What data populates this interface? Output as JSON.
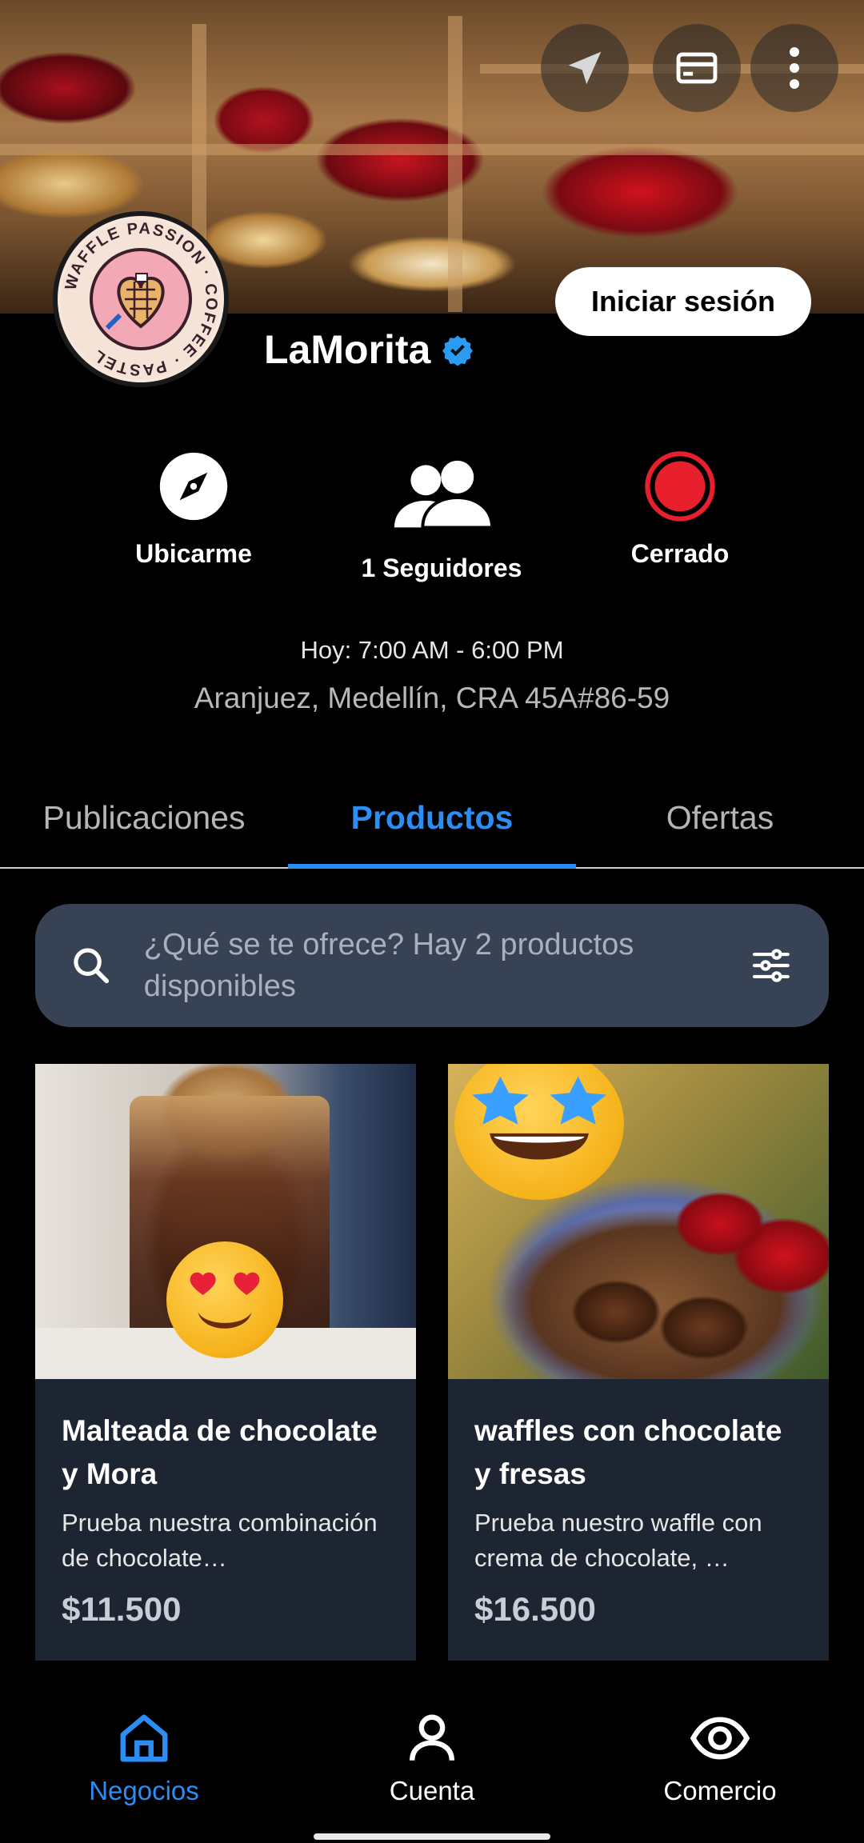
{
  "header": {
    "login_label": "Iniciar sesión",
    "logo_text": "WAFFLE PASSION · COFFEE · PASTEL",
    "business_name": "LaMorita"
  },
  "actions": [
    {
      "label": "Ubicarme",
      "icon": "compass-icon"
    },
    {
      "label": "1 Seguidores",
      "icon": "users-icon"
    },
    {
      "label": "Cerrado",
      "icon": "closed-status-icon"
    }
  ],
  "info": {
    "hours": "Hoy: 7:00 AM - 6:00 PM",
    "address": "Aranjuez, Medellín, CRA 45A#86-59"
  },
  "tabs": [
    {
      "label": "Publicaciones",
      "active": false
    },
    {
      "label": "Productos",
      "active": true
    },
    {
      "label": "Ofertas",
      "active": false
    }
  ],
  "search": {
    "placeholder": "¿Qué se te ofrece? Hay 2 productos disponibles"
  },
  "products": [
    {
      "title": "Malteada de chocolate y Mora",
      "description": "Prueba nuestra combinación de chocolate…",
      "price": "$11.500"
    },
    {
      "title": "waffles con chocolate y fresas",
      "description": "Prueba nuestro waffle con crema de chocolate, …",
      "price": "$16.500"
    }
  ],
  "bottom_nav": [
    {
      "label": "Negocios",
      "active": true
    },
    {
      "label": "Cuenta",
      "active": false
    },
    {
      "label": "Comercio",
      "active": false
    }
  ],
  "colors": {
    "accent": "#2b8ef4",
    "closed": "#e8202e",
    "card_bg": "#1e2532",
    "search_bg": "#374354"
  }
}
